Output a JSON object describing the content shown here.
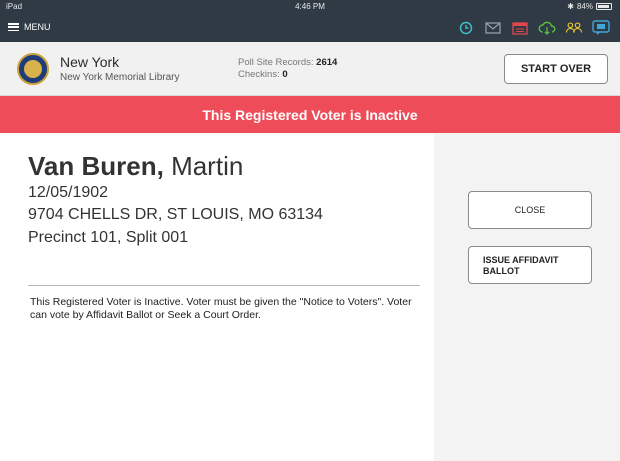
{
  "status_bar": {
    "device": "iPad",
    "time": "4:46 PM",
    "battery": "84%"
  },
  "menu": {
    "label": "MENU"
  },
  "toolbar_icons": [
    "clock-icon",
    "mail-icon",
    "calendar-icon",
    "cloud-sync-icon",
    "users-icon",
    "chat-icon"
  ],
  "header": {
    "state": "New York",
    "location": "New York Memorial Library",
    "poll_site_records_label": "Poll Site Records:",
    "poll_site_records_value": "2614",
    "checkins_label": "Checkins:",
    "checkins_value": "0",
    "start_over_label": "START OVER"
  },
  "banner": {
    "text": "This Registered Voter is Inactive",
    "color": "#ef4c59"
  },
  "voter": {
    "last_name": "Van Buren,",
    "first_name": "Martin",
    "birth_date": "12/05/1902",
    "address": "9704 CHELLS DR, ST LOUIS, MO 63134",
    "precinct": "Precinct 101, Split 001"
  },
  "notice": {
    "text": "This Registered Voter is Inactive.  Voter must be given the \"Notice to Voters\".  Voter can vote by Affidavit Ballot or Seek a Court Order."
  },
  "actions": {
    "close_label": "CLOSE",
    "affidavit_label": "ISSUE AFFIDAVIT BALLOT"
  }
}
